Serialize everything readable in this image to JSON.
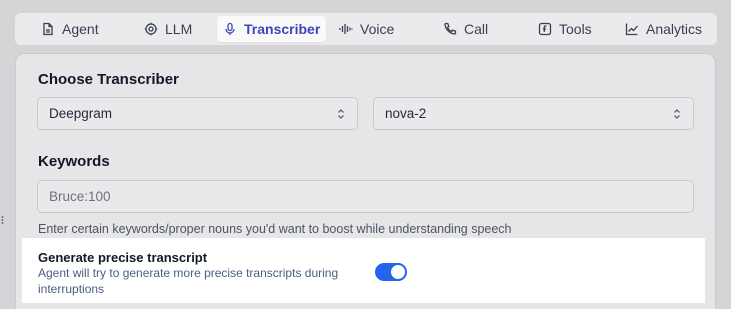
{
  "tabs": [
    {
      "label": "Agent",
      "icon": "document-icon"
    },
    {
      "label": "LLM",
      "icon": "gear-icon"
    },
    {
      "label": "Transcriber",
      "icon": "microphone-icon"
    },
    {
      "label": "Voice",
      "icon": "waveform-icon"
    },
    {
      "label": "Call",
      "icon": "phone-icon"
    },
    {
      "label": "Tools",
      "icon": "function-icon"
    },
    {
      "label": "Analytics",
      "icon": "chart-icon"
    }
  ],
  "active_tab": "Transcriber",
  "transcriber": {
    "title": "Choose Transcriber",
    "provider_value": "Deepgram",
    "model_value": "nova-2"
  },
  "keywords": {
    "title": "Keywords",
    "placeholder": "Bruce:100",
    "help": "Enter certain keywords/proper nouns you'd want to boost while understanding speech"
  },
  "precise": {
    "title": "Generate precise transcript",
    "description": "Agent will try to generate more precise transcripts during interruptions",
    "enabled": true
  },
  "colors": {
    "accent": "#2563eb",
    "active_tab_text": "#3b46b8"
  }
}
